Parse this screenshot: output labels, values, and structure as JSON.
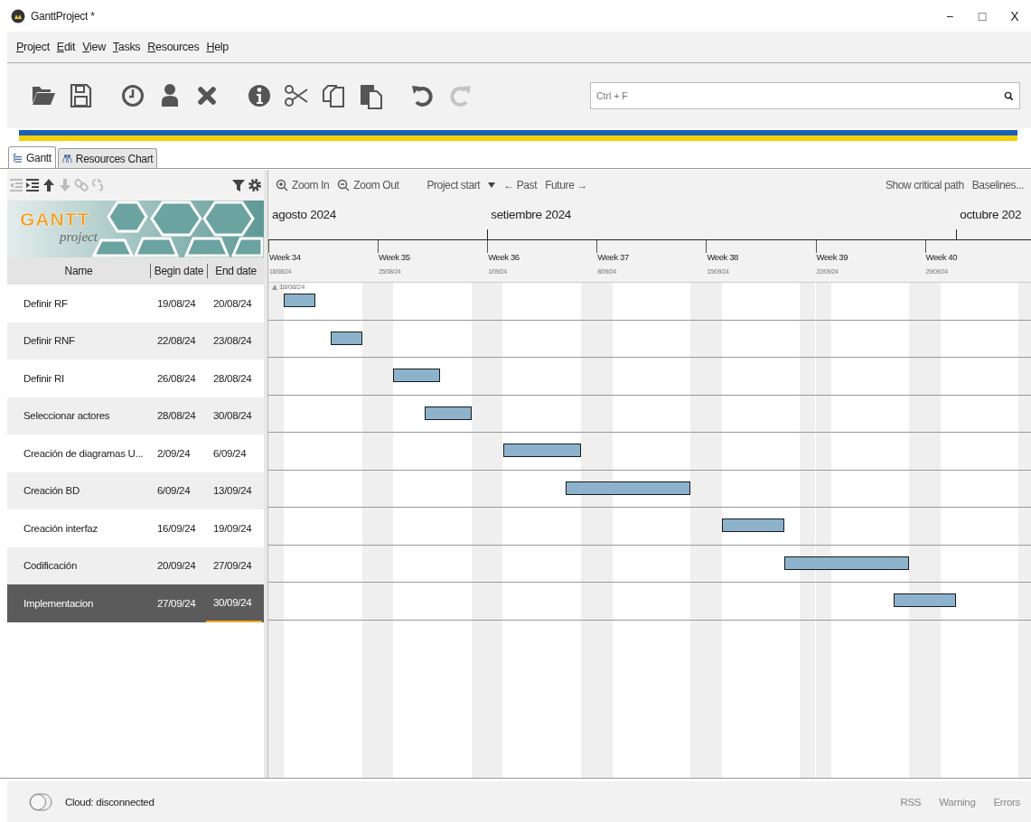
{
  "window": {
    "title": "GanttProject *",
    "controls": [
      "−",
      "□",
      "X"
    ]
  },
  "menu": [
    {
      "label": "Project"
    },
    {
      "label": "Edit"
    },
    {
      "label": "View"
    },
    {
      "label": "Tasks"
    },
    {
      "label": "Resources"
    },
    {
      "label": "Help"
    }
  ],
  "toolbar": {
    "groups": [
      [
        {
          "kind": "open",
          "disabled": false
        },
        {
          "kind": "save",
          "disabled": false
        }
      ],
      [
        {
          "kind": "clock",
          "disabled": false
        },
        {
          "kind": "person",
          "disabled": false
        },
        {
          "kind": "delete",
          "disabled": false
        }
      ],
      [
        {
          "kind": "info",
          "disabled": false
        },
        {
          "kind": "cut",
          "disabled": false
        },
        {
          "kind": "copy",
          "disabled": false
        },
        {
          "kind": "paste",
          "disabled": false
        }
      ],
      [
        {
          "kind": "undo",
          "disabled": false
        },
        {
          "kind": "redo",
          "disabled": true
        }
      ]
    ],
    "search": {
      "placeholder": "Ctrl + F"
    }
  },
  "tabs": [
    {
      "label": "Gantt",
      "kind": "gantt",
      "selected": true
    },
    {
      "label": "Resources Chart",
      "kind": "resources",
      "selected": false
    }
  ],
  "task_toolbar": {
    "left": [
      {
        "kind": "unindent",
        "disabled": true
      },
      {
        "kind": "indent",
        "disabled": false
      },
      {
        "kind": "up",
        "disabled": false
      },
      {
        "kind": "down",
        "disabled": true
      },
      {
        "kind": "link",
        "disabled": true
      },
      {
        "kind": "unlink",
        "disabled": true
      }
    ],
    "right": [
      {
        "kind": "filter",
        "disabled": false
      },
      {
        "kind": "gear",
        "disabled": false
      }
    ]
  },
  "logo": {
    "title": "GANTT",
    "subtitle": "project"
  },
  "table": {
    "columns": [
      "Name",
      "Begin date",
      "End date"
    ],
    "rows": [
      {
        "name": "Definir RF",
        "begin": "19/08/24",
        "end": "20/08/24",
        "selected": false
      },
      {
        "name": "Definir RNF",
        "begin": "22/08/24",
        "end": "23/08/24",
        "selected": false
      },
      {
        "name": "Definir RI",
        "begin": "26/08/24",
        "end": "28/08/24",
        "selected": false
      },
      {
        "name": "Seleccionar actores",
        "begin": "28/08/24",
        "end": "30/08/24",
        "selected": false
      },
      {
        "name": "Creación de diagramas U...",
        "begin": "2/09/24",
        "end": "6/09/24",
        "selected": false
      },
      {
        "name": "Creación BD",
        "begin": "6/09/24",
        "end": "13/09/24",
        "selected": false
      },
      {
        "name": "Creación interfaz",
        "begin": "16/09/24",
        "end": "19/09/24",
        "selected": false
      },
      {
        "name": "Codificación",
        "begin": "20/09/24",
        "end": "27/09/24",
        "selected": false
      },
      {
        "name": "Implementacion",
        "begin": "27/09/24",
        "end": "30/09/24",
        "selected": true
      }
    ]
  },
  "chart_toolbar": {
    "zoom_in": "Zoom In",
    "zoom_out": "Zoom Out",
    "project_start": "Project start",
    "past": "← Past",
    "future": "Future →",
    "critical_path": "Show critical path",
    "baselines": "Baselines..."
  },
  "timeline": {
    "months": [
      "agosto 2024",
      "setiembre 2024",
      "octubre 202"
    ],
    "weeks": [
      {
        "label": "Week 34",
        "date": "18/08/24"
      },
      {
        "label": "Week 35",
        "date": "25/08/24"
      },
      {
        "label": "Week 36",
        "date": "1/09/24"
      },
      {
        "label": "Week 37",
        "date": "8/09/24"
      },
      {
        "label": "Week 38",
        "date": "15/09/24"
      },
      {
        "label": "Week 39",
        "date": "22/09/24"
      },
      {
        "label": "Week 40",
        "date": "29/09/24"
      }
    ],
    "start_marker": "18/08/24"
  },
  "status_bar": {
    "cloud": "Cloud: disconnected",
    "links": [
      "RSS",
      "Warning",
      "Errors"
    ]
  }
}
